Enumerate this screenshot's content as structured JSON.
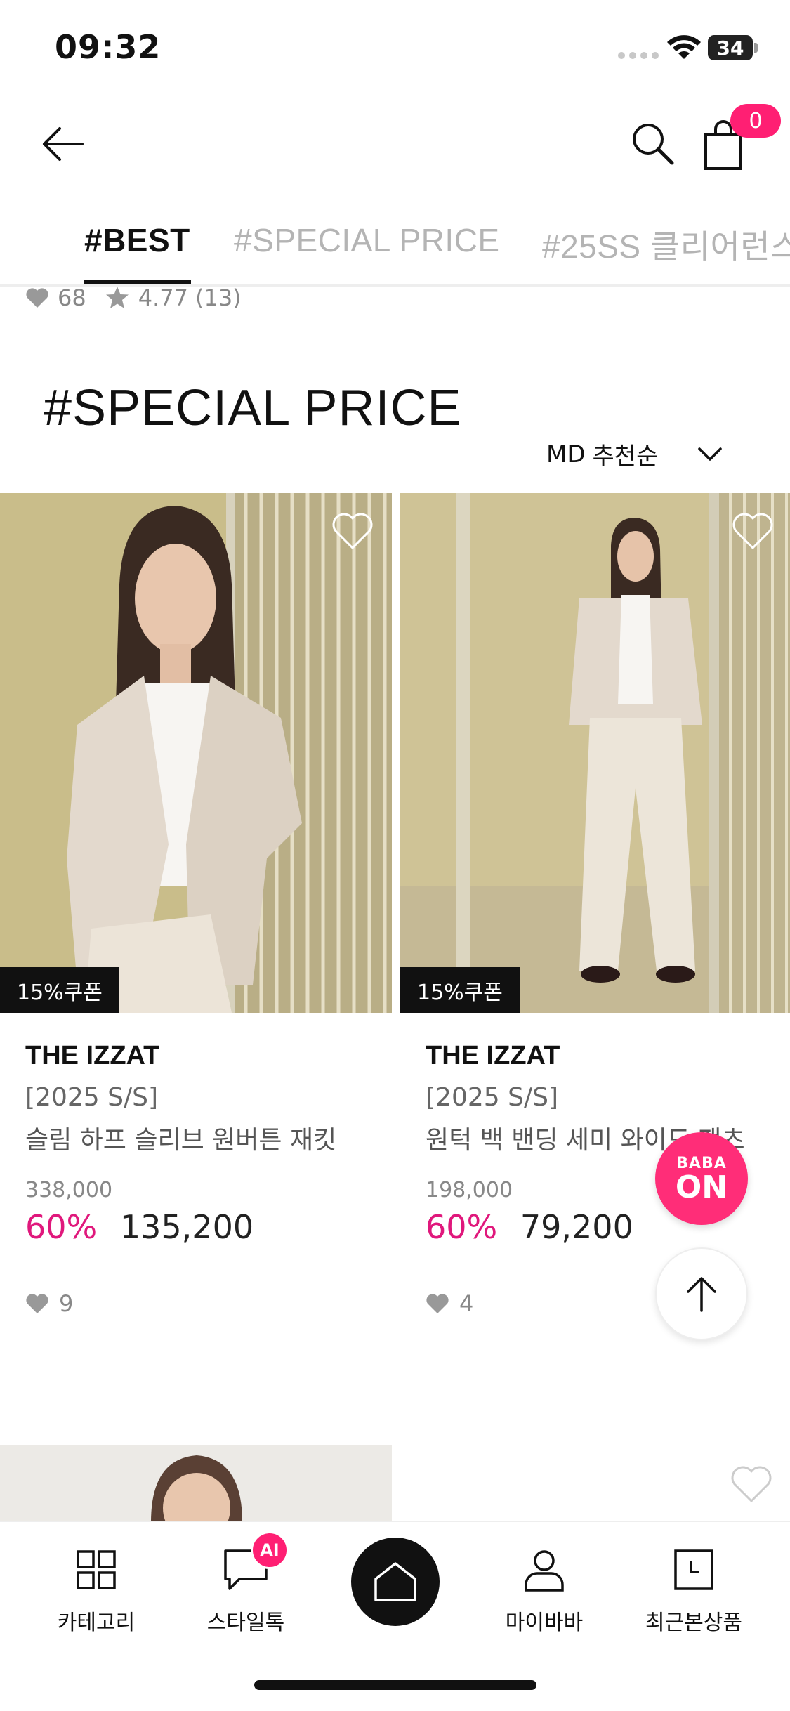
{
  "status_bar": {
    "time": "09:32",
    "battery": "34"
  },
  "header": {
    "cart_count": "0"
  },
  "tabs": [
    {
      "label": "#BEST",
      "active": true
    },
    {
      "label": "#SPECIAL PRICE",
      "active": false
    },
    {
      "label": "#25SS 클리어런스",
      "active": false
    }
  ],
  "prev_item": {
    "likes": "68",
    "rating": "4.77",
    "reviews": "(13)"
  },
  "section": {
    "title": "#SPECIAL PRICE",
    "sort_prefix": "MD",
    "sort_label": "추천순"
  },
  "products": [
    {
      "coupon": "15%쿠폰",
      "brand": "THE IZZAT",
      "season": "[2025 S/S]",
      "name": "슬림 하프 슬리브 원버튼 재킷",
      "original_price": "338,000",
      "discount": "60%",
      "sale_price": "135,200",
      "likes": "9"
    },
    {
      "coupon": "15%쿠폰",
      "brand": "THE IZZAT",
      "season": "[2025 S/S]",
      "name": "원턱 백 밴딩 세미 와이드 팬츠",
      "original_price": "198,000",
      "discount": "60%",
      "sale_price": "79,200",
      "likes": "4"
    }
  ],
  "floating": {
    "baba_small": "BABA",
    "baba_big": "ON"
  },
  "bottom_nav": {
    "items": [
      {
        "label": "카테고리"
      },
      {
        "label": "스타일톡",
        "badge": "AI"
      },
      {
        "label": "마이바바"
      },
      {
        "label": "최근본상품"
      }
    ]
  },
  "colors": {
    "accent": "#ff1f73",
    "discount": "#e0187c",
    "text": "#111111"
  }
}
